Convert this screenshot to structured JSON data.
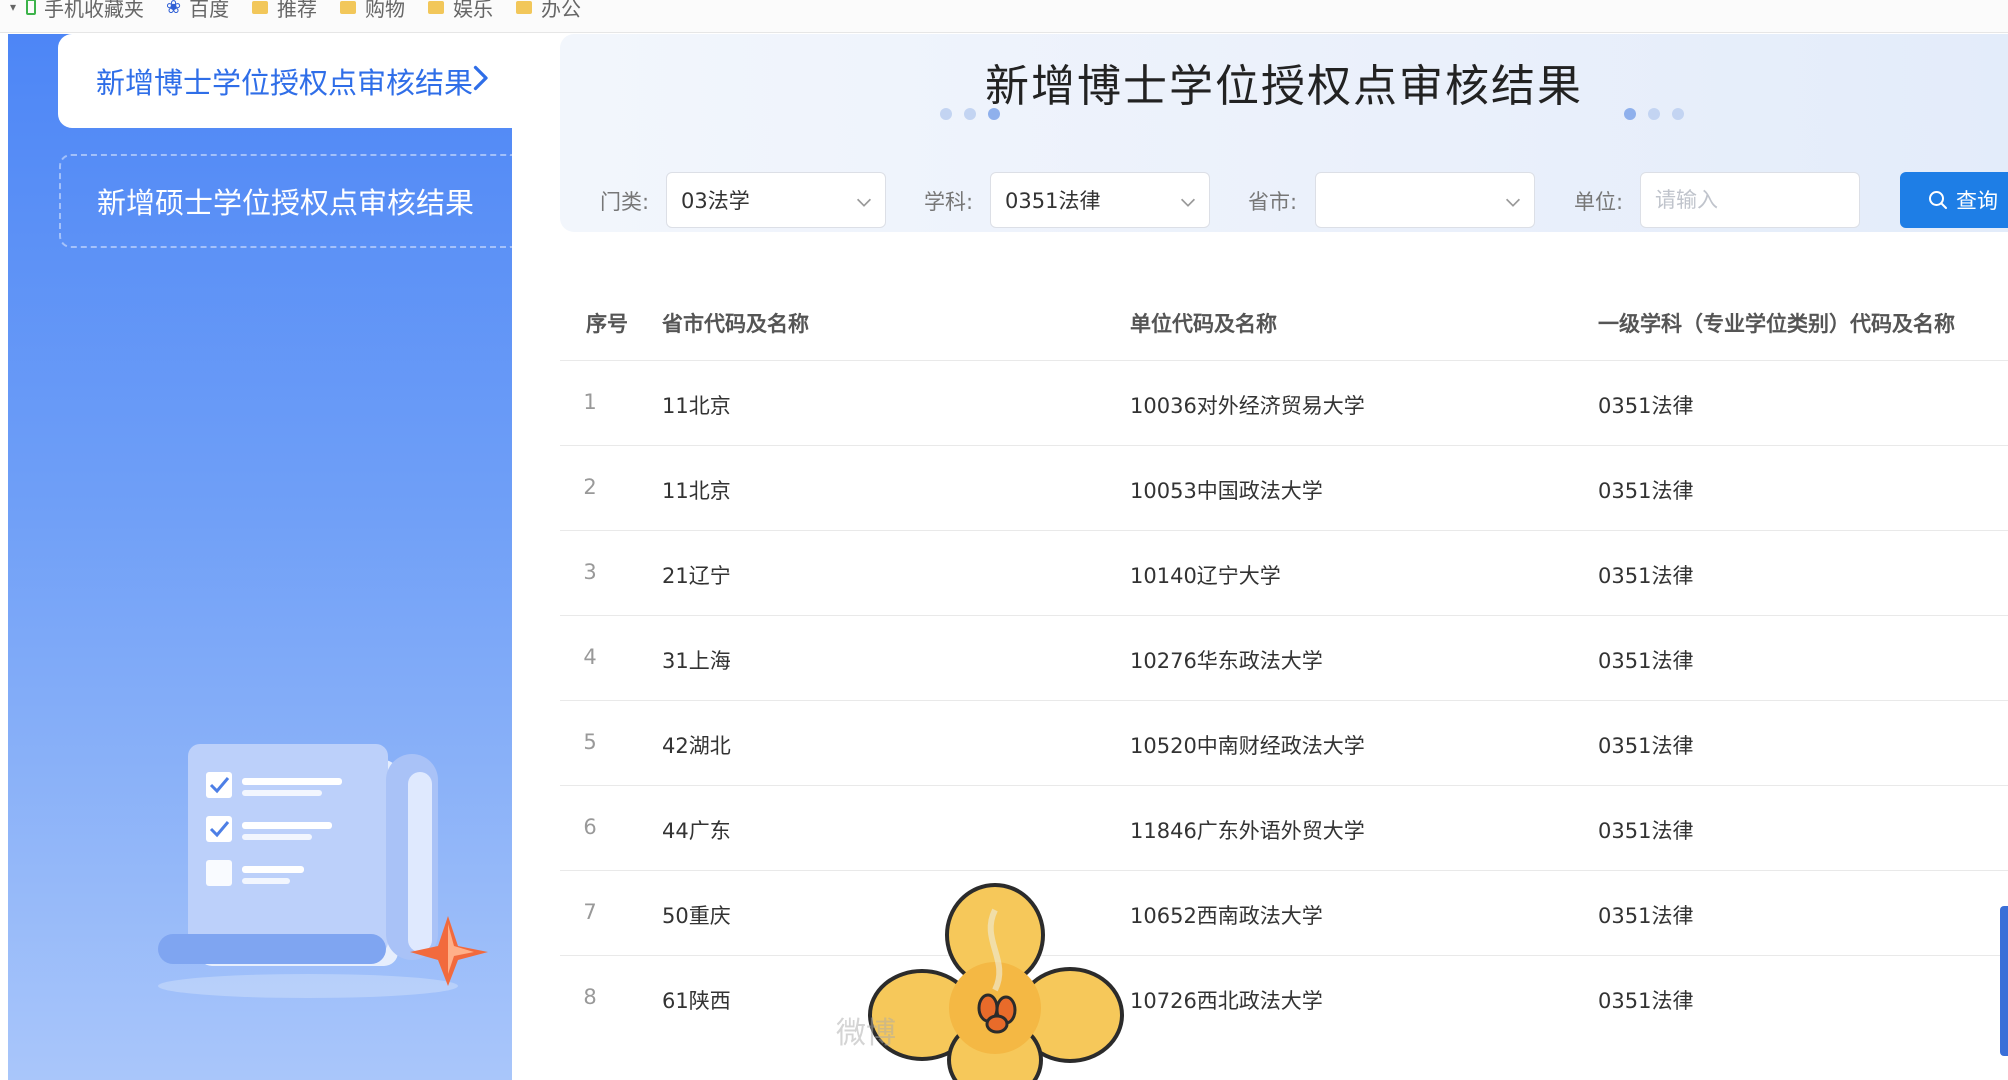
{
  "bookmarks": [
    "手机收藏夹",
    "百度",
    "推荐",
    "购物",
    "娱乐",
    "办公"
  ],
  "sidebar": {
    "items": [
      {
        "label": "新增博士学位授权点审核结果"
      },
      {
        "label": "新增硕士学位授权点审核结果"
      }
    ]
  },
  "page_title": "新增博士学位授权点审核结果",
  "filters": {
    "category": {
      "label": "门类:",
      "value": "03法学"
    },
    "discipline": {
      "label": "学科:",
      "value": "0351法律"
    },
    "province": {
      "label": "省市:",
      "value": ""
    },
    "unit": {
      "label": "单位:",
      "placeholder": "请输入"
    },
    "query_label": "查询"
  },
  "table": {
    "headers": [
      "序号",
      "省市代码及名称",
      "单位代码及名称",
      "一级学科（专业学位类别）代码及名称"
    ],
    "rows": [
      [
        "1",
        "11北京",
        "10036对外经济贸易大学",
        "0351法律"
      ],
      [
        "2",
        "11北京",
        "10053中国政法大学",
        "0351法律"
      ],
      [
        "3",
        "21辽宁",
        "10140辽宁大学",
        "0351法律"
      ],
      [
        "4",
        "31上海",
        "10276华东政法大学",
        "0351法律"
      ],
      [
        "5",
        "42湖北",
        "10520中南财经政法大学",
        "0351法律"
      ],
      [
        "6",
        "44广东",
        "11846广东外语外贸大学",
        "0351法律"
      ],
      [
        "7",
        "50重庆",
        "10652西南政法大学",
        "0351法律"
      ],
      [
        "8",
        "61陕西",
        "10726西北政法大学",
        "0351法律"
      ]
    ]
  },
  "watermark": "微博",
  "colors": {
    "accent": "#2f6ee8",
    "button": "#1e7ee6",
    "sidebar": "#4d86f6"
  }
}
